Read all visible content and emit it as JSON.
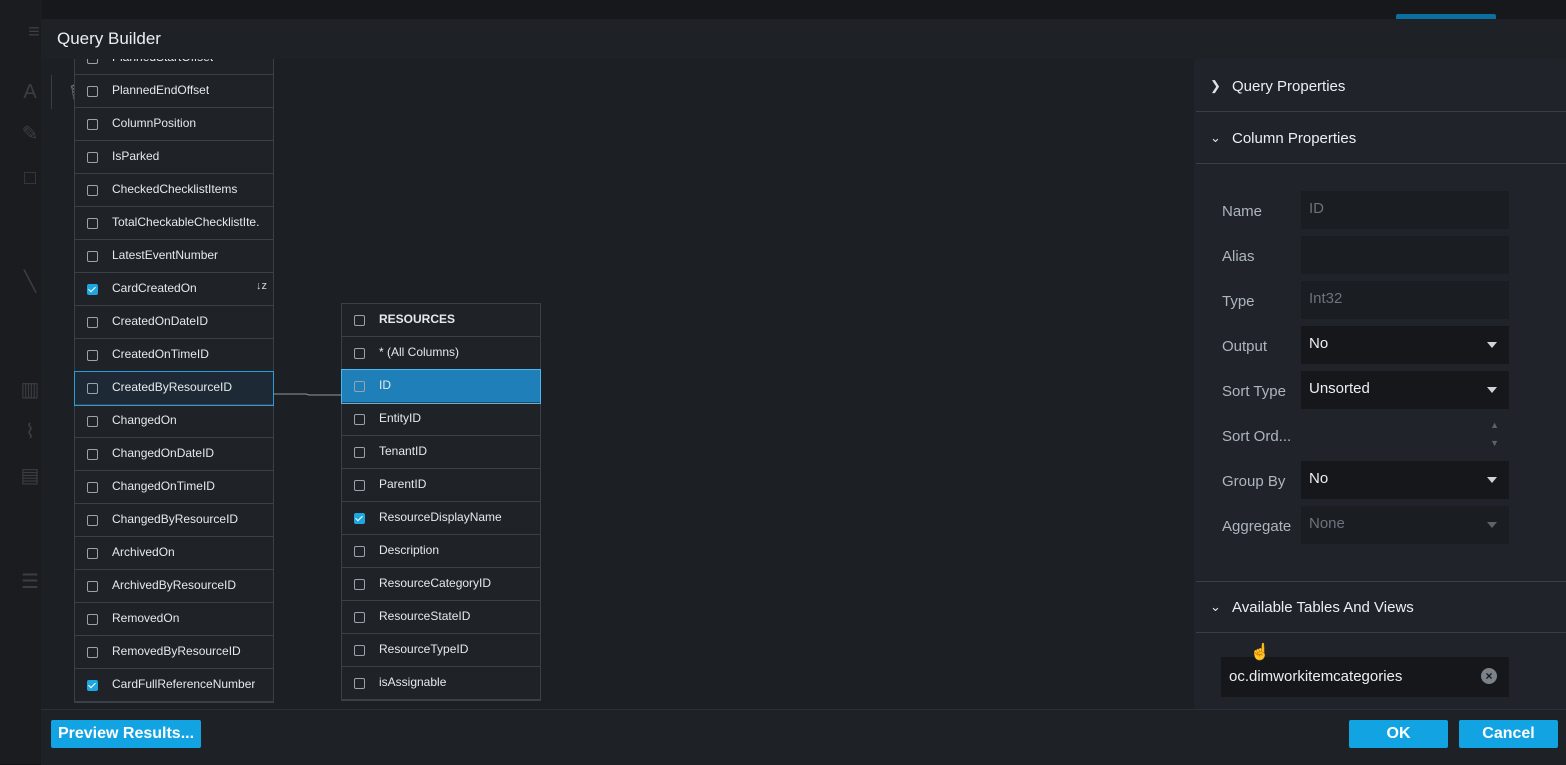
{
  "dialog": {
    "title": "Query Builder"
  },
  "table_left": {
    "rows": [
      {
        "label": "PlannedStartOffset",
        "checked": false
      },
      {
        "label": "PlannedEndOffset",
        "checked": false
      },
      {
        "label": "ColumnPosition",
        "checked": false
      },
      {
        "label": "IsParked",
        "checked": false
      },
      {
        "label": "CheckedChecklistItems",
        "checked": false
      },
      {
        "label": "TotalCheckableChecklistIte...",
        "checked": false
      },
      {
        "label": "LatestEventNumber",
        "checked": false
      },
      {
        "label": "CardCreatedOn",
        "checked": true,
        "sort_icon": "↓z"
      },
      {
        "label": "CreatedOnDateID",
        "checked": false
      },
      {
        "label": "CreatedOnTimeID",
        "checked": false
      },
      {
        "label": "CreatedByResourceID",
        "checked": false
      },
      {
        "label": "ChangedOn",
        "checked": false
      },
      {
        "label": "ChangedOnDateID",
        "checked": false
      },
      {
        "label": "ChangedOnTimeID",
        "checked": false
      },
      {
        "label": "ChangedByResourceID",
        "checked": false
      },
      {
        "label": "ArchivedOn",
        "checked": false
      },
      {
        "label": "ArchivedByResourceID",
        "checked": false
      },
      {
        "label": "RemovedOn",
        "checked": false
      },
      {
        "label": "RemovedByResourceID",
        "checked": false
      },
      {
        "label": "CardFullReferenceNumber",
        "checked": true
      }
    ]
  },
  "table_resources": {
    "header": "RESOURCES",
    "rows": [
      {
        "label": "* (All Columns)",
        "checked": false
      },
      {
        "label": "ID",
        "checked": false
      },
      {
        "label": "EntityID",
        "checked": false
      },
      {
        "label": "TenantID",
        "checked": false
      },
      {
        "label": "ParentID",
        "checked": false
      },
      {
        "label": "ResourceDisplayName",
        "checked": true
      },
      {
        "label": "Description",
        "checked": false
      },
      {
        "label": "ResourceCategoryID",
        "checked": false
      },
      {
        "label": "ResourceStateID",
        "checked": false
      },
      {
        "label": "ResourceTypeID",
        "checked": false
      },
      {
        "label": "isAssignable",
        "checked": false
      }
    ]
  },
  "right_panel": {
    "query_properties": "Query Properties",
    "column_properties": "Column Properties",
    "available_tables": "Available Tables And Views",
    "props": {
      "name_label": "Name",
      "name_value": "ID",
      "alias_label": "Alias",
      "alias_value": "",
      "type_label": "Type",
      "type_value": "Int32",
      "output_label": "Output",
      "output_value": "No",
      "sort_type_label": "Sort Type",
      "sort_type_value": "Unsorted",
      "sort_order_label": "Sort Ord...",
      "sort_order_value": "",
      "group_by_label": "Group By",
      "group_by_value": "No",
      "aggregate_label": "Aggregate",
      "aggregate_value": "None"
    },
    "search_value": "oc.dimworkitemcategories"
  },
  "footer": {
    "preview": "Preview Results...",
    "ok": "OK",
    "cancel": "Cancel"
  },
  "colors": {
    "accent": "#12a3e3",
    "selection": "#1f7fb8",
    "dialog_bg": "#1e2227"
  }
}
